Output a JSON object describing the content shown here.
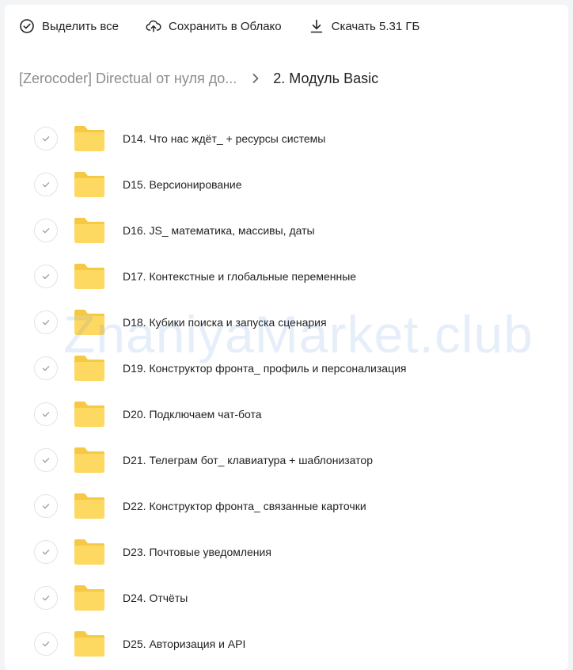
{
  "toolbar": {
    "select_all": "Выделить все",
    "save_cloud": "Сохранить в Облако",
    "download": "Скачать 5.31 ГБ"
  },
  "breadcrumb": {
    "parent": "[Zerocoder] Directual от нуля до...",
    "current": "2. Модуль Basic"
  },
  "folders": [
    "D14. Что нас ждёт_ + ресурсы системы",
    "D15. Версионирование",
    "D16. JS_ математика, массивы, даты",
    "D17. Контекстные и глобальные переменные",
    "D18. Кубики поиска и запуска сценария",
    "D19. Конструктор фронта_ профиль и персонализация",
    "D20. Подключаем чат-бота",
    "D21. Телеграм бот_ клавиатура + шаблонизатор",
    "D22. Конструктор фронта_ связанные карточки",
    "D23. Почтовые уведомления",
    "D24. Отчёты",
    "D25. Авторизация и API"
  ],
  "watermark": "ZnaniyaMarket.club",
  "colors": {
    "folder": "#fed961",
    "folder_tab": "#f6c945",
    "check_border": "#e3e3e3",
    "muted_text": "#8c8c8c"
  }
}
